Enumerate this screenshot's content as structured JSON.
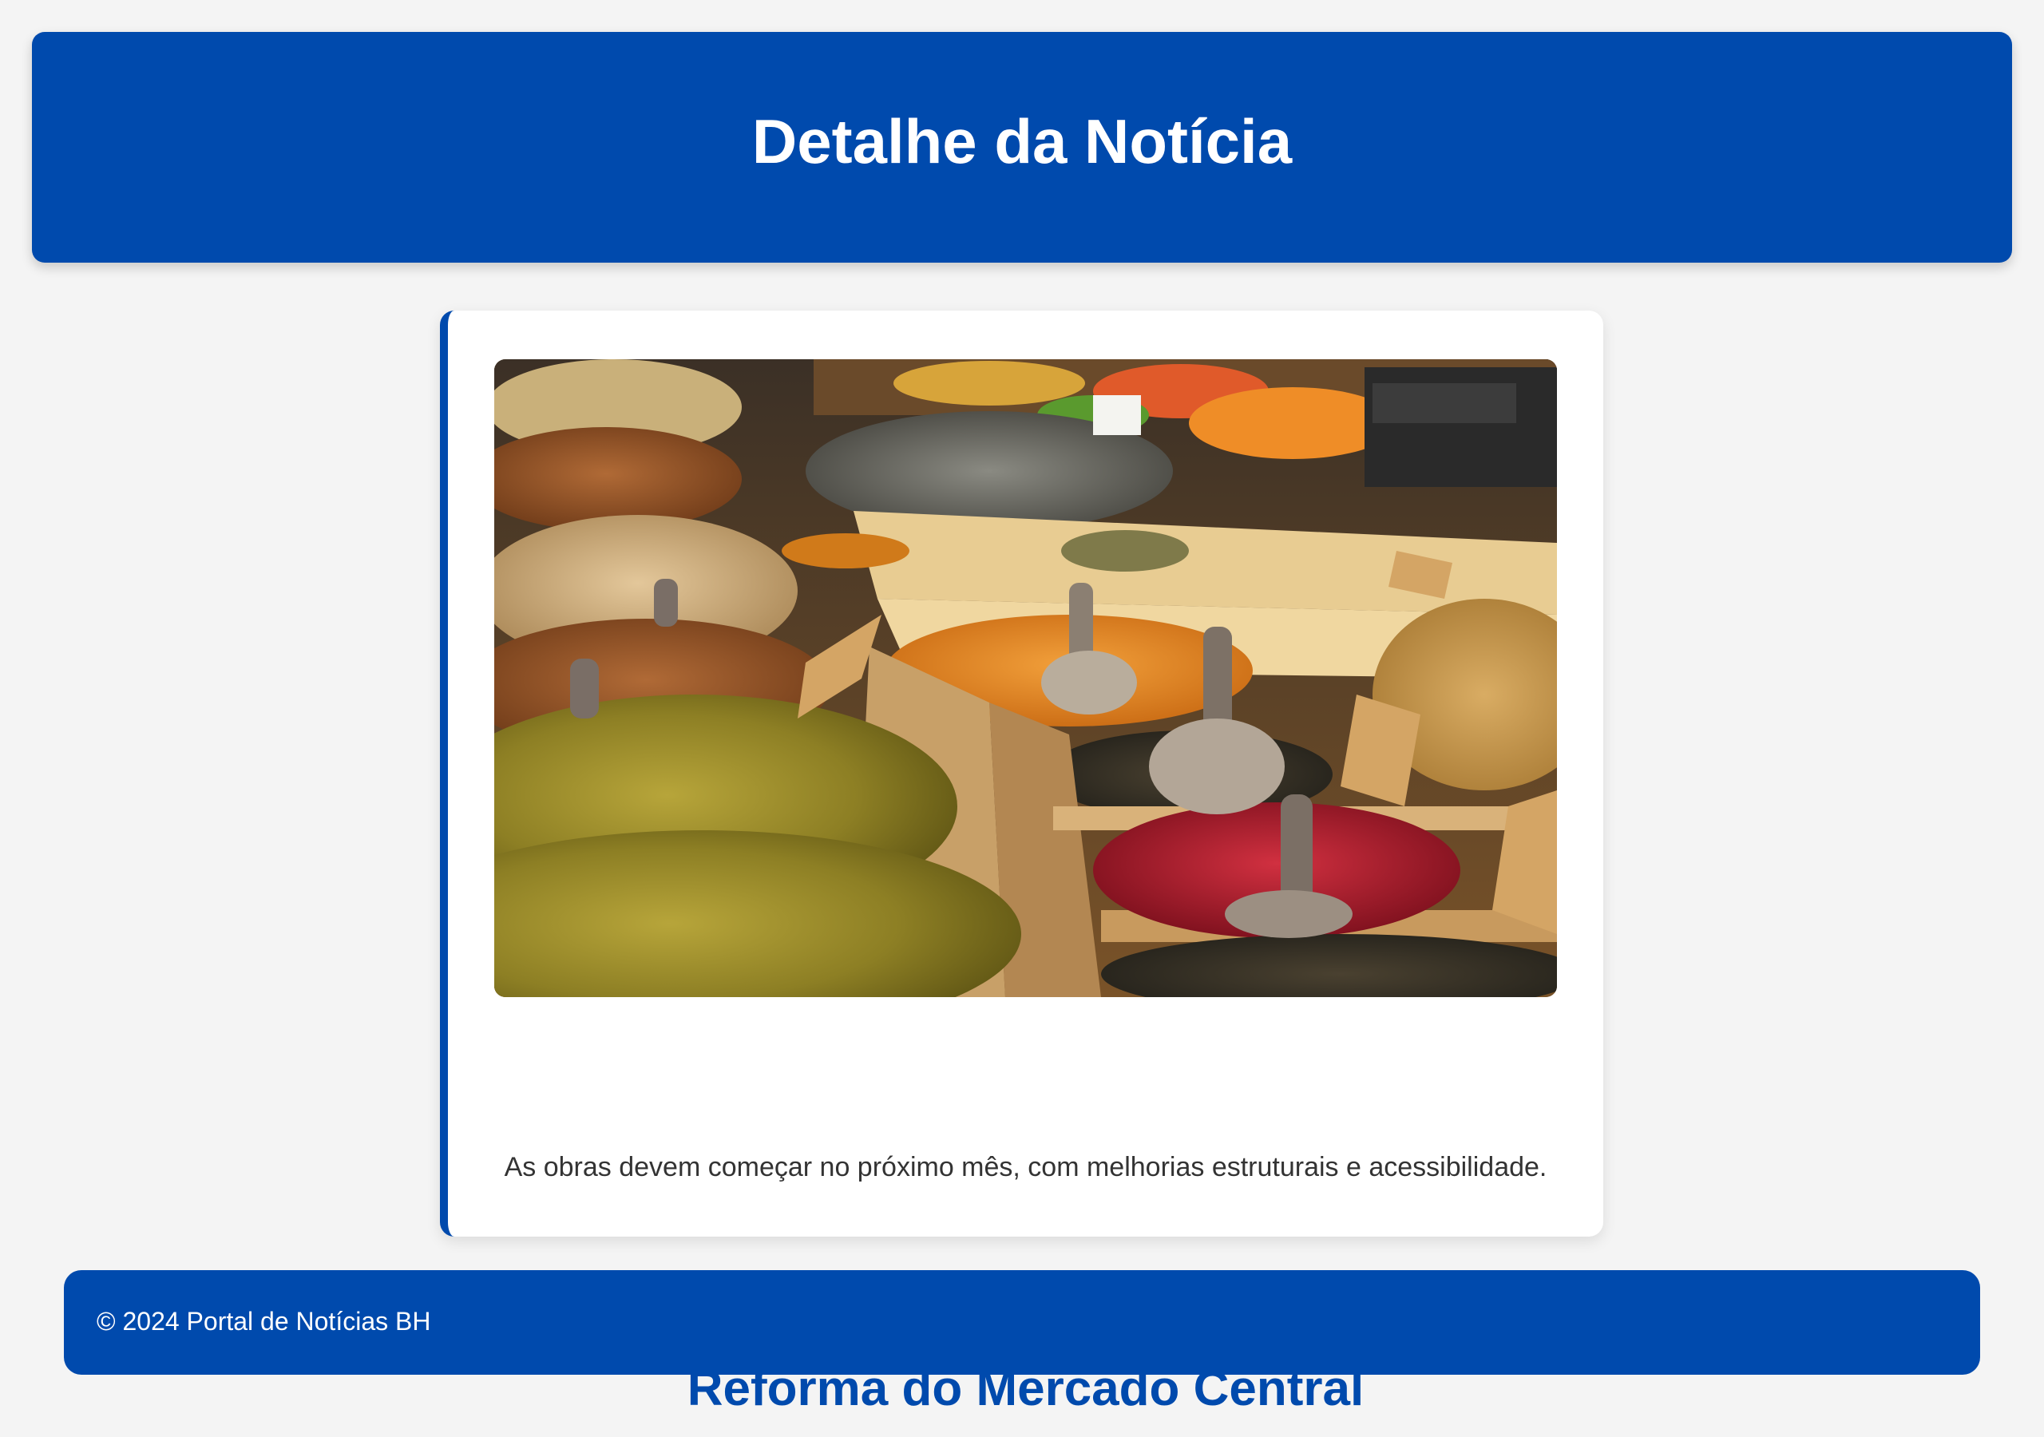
{
  "header": {
    "title": "Detalhe da Notícia"
  },
  "article": {
    "image_description": "market-spices-photo",
    "title": "Reforma do Mercado Central",
    "summary": "As obras devem começar no próximo mês, com melhorias estruturais e acessibilidade."
  },
  "footer": {
    "copyright": "© 2024 Portal de Notícias BH"
  },
  "colors": {
    "brand": "#004aad",
    "page_background": "#f4f4f4",
    "card_background": "#ffffff",
    "body_text": "#333333"
  }
}
